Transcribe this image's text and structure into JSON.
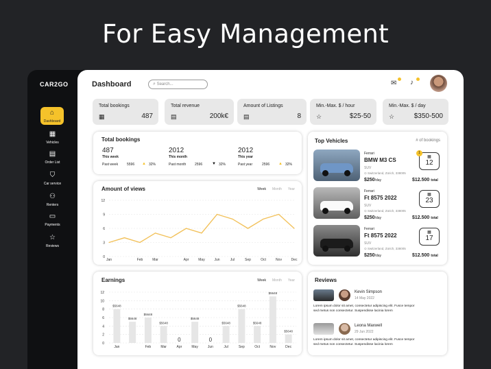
{
  "hero": {
    "title": "For Easy Management"
  },
  "app": {
    "logo": "CAR2GO"
  },
  "sidebar": {
    "items": [
      {
        "label": "Dashboard",
        "icon": "home-icon"
      },
      {
        "label": "Vehicles",
        "icon": "grid-icon"
      },
      {
        "label": "Order List",
        "icon": "document-icon"
      },
      {
        "label": "Car service",
        "icon": "shield-icon"
      },
      {
        "label": "Renters",
        "icon": "users-icon"
      },
      {
        "label": "Payments",
        "icon": "card-icon"
      },
      {
        "label": "Reviews",
        "icon": "star-icon"
      }
    ]
  },
  "header": {
    "title": "Dashboard",
    "search_placeholder": "Search..."
  },
  "stats": [
    {
      "label": "Total bookings",
      "value": "487",
      "icon": "calendar-icon"
    },
    {
      "label": "Total revenue",
      "value": "200k€",
      "icon": "money-icon"
    },
    {
      "label": "Amount of Listings",
      "value": "8",
      "icon": "list-icon"
    },
    {
      "label": "Min.-Max. $ / hour",
      "value": "$25-50",
      "icon": "star-icon"
    },
    {
      "label": "Min.-Max. $ / day",
      "value": "$350-500",
      "icon": "star-icon"
    }
  ],
  "total_bookings": {
    "title": "Total bookings",
    "columns": [
      {
        "value": "487",
        "period": "This week",
        "prev_label": "Past week",
        "prev_value": "5596",
        "change": "32%",
        "direction": "up"
      },
      {
        "value": "2012",
        "period": "This month",
        "prev_label": "Past month",
        "prev_value": "2596",
        "change": "32%",
        "direction": "down"
      },
      {
        "value": "2012",
        "period": "This year",
        "prev_label": "Past year",
        "prev_value": "2596",
        "change": "32%",
        "direction": "up"
      }
    ]
  },
  "views": {
    "title": "Amount of views",
    "tabs": [
      "Week",
      "Month",
      "Year"
    ],
    "active_tab": "Week"
  },
  "earnings": {
    "title": "Earnings",
    "tabs": [
      "Week",
      "Month",
      "Year"
    ],
    "active_tab": "Week"
  },
  "chart_data": [
    {
      "type": "line",
      "categories": [
        "Jan",
        "Feb",
        "Mar",
        "Apr",
        "May",
        "Jun",
        "Jul",
        "Sep",
        "Oct",
        "Nov",
        "Dec"
      ],
      "values": [
        3,
        4,
        3,
        5,
        4,
        6,
        5,
        9,
        8,
        6,
        8,
        9,
        6
      ],
      "x_positions": [
        "Jan",
        "",
        "Feb",
        "Mar",
        "",
        "Apr",
        "May",
        "Jun",
        "Jul",
        "Sep",
        "Oct",
        "Nov",
        "Dec"
      ],
      "yticks": [
        0,
        3,
        6,
        9,
        12
      ],
      "ylim": [
        0,
        12
      ],
      "color": "#f2c15a"
    },
    {
      "type": "bar",
      "categories": [
        "Jan",
        "Feb",
        "Mar",
        "Apr",
        "May",
        "Jun",
        "Jul",
        "Sep",
        "Oct",
        "Nov",
        "Dec"
      ],
      "values": [
        8,
        5,
        6,
        4,
        0,
        5,
        0,
        4,
        8,
        4,
        11,
        2
      ],
      "labels": [
        "$5648",
        "$5648",
        "$5648",
        "$5648",
        "0",
        "$5648",
        "0",
        "$5648",
        "$5648",
        "$5648",
        "$5648",
        "$5648"
      ],
      "tick_labels": [
        "Jan",
        "",
        "Feb",
        "Mar",
        "Apr",
        "May",
        "Jun",
        "Jul",
        "Sep",
        "Oct",
        "Nov",
        "Dec"
      ],
      "yticks": [
        0,
        2,
        4,
        6,
        8,
        10,
        12
      ],
      "ylim": [
        0,
        12
      ]
    }
  ],
  "top_vehicles": {
    "title": "Top Vehicles",
    "hint": "# of bookings",
    "items": [
      {
        "brand": "Ferrari",
        "model": "BMW M3 CS",
        "type": "SUV",
        "location": "Switzerland, Zürich, 338005",
        "price_day": "$250",
        "per": "/day",
        "total": "$12.500",
        "total_label": "total",
        "bookings": "12",
        "rank": "1"
      },
      {
        "brand": "Ferrari",
        "model": "Ft 8575 2022",
        "type": "SUV",
        "location": "Switzerland, Zürich, 338005",
        "price_day": "$250",
        "per": "/day",
        "total": "$12.500",
        "total_label": "total",
        "bookings": "23",
        "rank": ""
      },
      {
        "brand": "Ferrari",
        "model": "Ft 8575 2022",
        "type": "SUV",
        "location": "Switzerland, Zürich, 338005",
        "price_day": "$250",
        "per": "/day",
        "total": "$12.500",
        "total_label": "total",
        "bookings": "17",
        "rank": ""
      }
    ]
  },
  "reviews": {
    "title": "Reviews",
    "items": [
      {
        "name": "Kevin Simpson",
        "date": "14 May 2022",
        "text1": "Lorem ipsum dolor sit amet, consectetur adipiscing elit. Fusce tempor",
        "text2": "sed metus non consectetur. Suspendisse lacinia lorem"
      },
      {
        "name": "Leona Maxwell",
        "date": "29 Jun 2022",
        "text1": "Lorem ipsum dolor sit amet, consectetur adipiscing elit. Fusce tempor",
        "text2": "sed metus non consectetur. Suspendisse lacinia lorem"
      }
    ]
  }
}
